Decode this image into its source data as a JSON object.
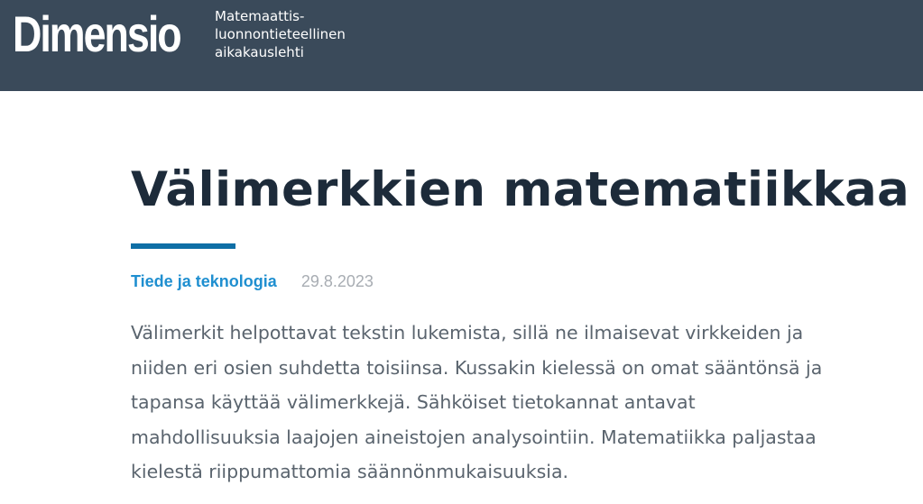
{
  "header": {
    "logo": "Dimensio",
    "tagline_lines": [
      "Matemaattis-",
      "luonnontieteellinen",
      "aikakauslehti"
    ],
    "background_color": "#3a4a5a"
  },
  "article": {
    "title": "Välimerkkien matematiikkaa",
    "accent_color": "#0f6fa6",
    "category": "Tiede ja teknologia",
    "date": "29.8.2023",
    "lead_lines": [
      "Välimerkit helpottavat tekstin lukemista, sillä ne ilmaisevat virkkeiden ja",
      "niiden eri osien suhdetta toisiinsa. Kussakin kielessä on omat sääntönsä ja",
      "tapansa käyttää välimerkkejä. Sähköiset tietokannat antavat",
      "mahdollisuuksia laajojen aineistojen analysointiin. Matematiikka paljastaa",
      "kielestä riippumattomia säännönmukaisuuksia."
    ]
  }
}
